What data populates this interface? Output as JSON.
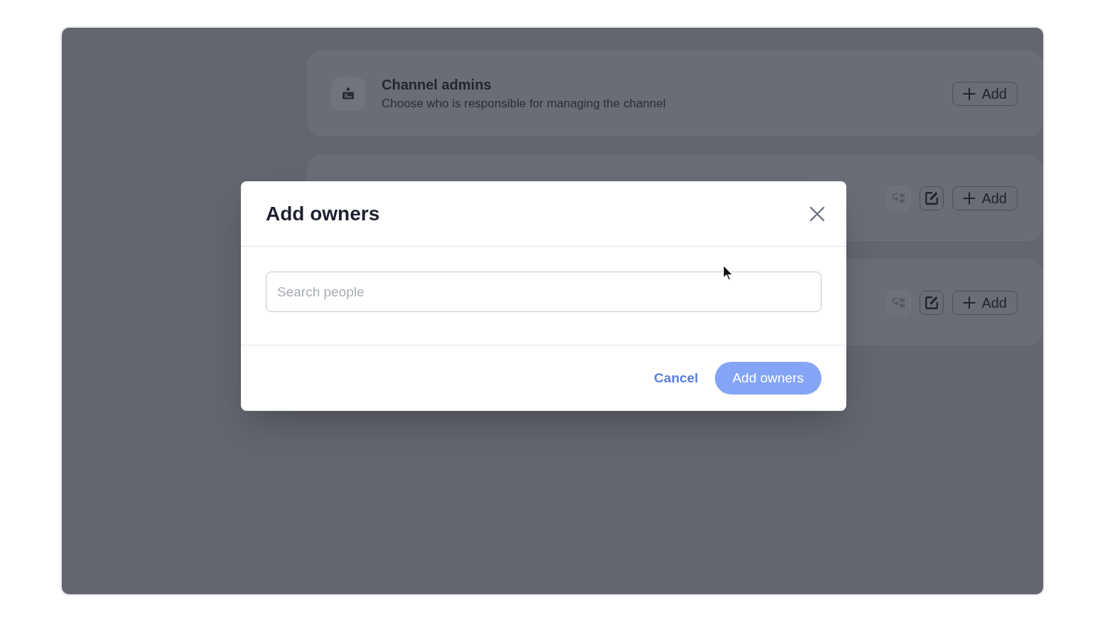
{
  "cards": [
    {
      "title": "Channel admins",
      "description": "Choose who is responsible for managing the channel",
      "actions": [
        {
          "kind": "add",
          "label": "Add"
        }
      ]
    },
    {
      "actions": [
        {
          "kind": "toggle",
          "disabled": true
        },
        {
          "kind": "edit",
          "disabled": false
        },
        {
          "kind": "add",
          "label": "Add"
        }
      ]
    },
    {
      "actions": [
        {
          "kind": "toggle",
          "disabled": true
        },
        {
          "kind": "edit",
          "disabled": false
        },
        {
          "kind": "add",
          "label": "Add"
        }
      ]
    }
  ],
  "dialog": {
    "title": "Add owners",
    "search": {
      "placeholder": "Search people"
    },
    "buttons": [
      {
        "kind": "link",
        "label": "Cancel"
      },
      {
        "kind": "primary",
        "label": "Add owners",
        "disabled": true
      }
    ]
  }
}
